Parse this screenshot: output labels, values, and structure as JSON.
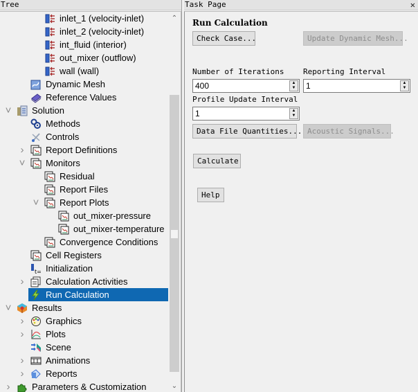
{
  "tree": {
    "header": "Tree",
    "items": [
      {
        "label": "inlet_1 (velocity-inlet)",
        "icon": "boundary-icon",
        "level": 3,
        "arrow": ""
      },
      {
        "label": "inlet_2 (velocity-inlet)",
        "icon": "boundary-icon",
        "level": 3,
        "arrow": ""
      },
      {
        "label": "int_fluid (interior)",
        "icon": "boundary-icon",
        "level": 3,
        "arrow": ""
      },
      {
        "label": "out_mixer (outflow)",
        "icon": "boundary-icon",
        "level": 3,
        "arrow": ""
      },
      {
        "label": "wall (wall)",
        "icon": "boundary-icon",
        "level": 3,
        "arrow": ""
      },
      {
        "label": "Dynamic Mesh",
        "icon": "dynamic-mesh-icon",
        "level": 2,
        "arrow": ""
      },
      {
        "label": "Reference Values",
        "icon": "book-icon",
        "level": 2,
        "arrow": ""
      },
      {
        "label": "Solution",
        "icon": "calculator-icon",
        "level": 1,
        "arrow": "expanded"
      },
      {
        "label": "Methods",
        "icon": "methods-icon",
        "level": 2,
        "arrow": ""
      },
      {
        "label": "Controls",
        "icon": "controls-icon",
        "level": 2,
        "arrow": ""
      },
      {
        "label": "Report Definitions",
        "icon": "report-icon",
        "level": 2,
        "arrow": "collapsed"
      },
      {
        "label": "Monitors",
        "icon": "report-icon",
        "level": 2,
        "arrow": "expanded"
      },
      {
        "label": "Residual",
        "icon": "report-icon",
        "level": 3,
        "arrow": ""
      },
      {
        "label": "Report Files",
        "icon": "report-icon",
        "level": 3,
        "arrow": ""
      },
      {
        "label": "Report Plots",
        "icon": "report-icon",
        "level": 3,
        "arrow": "expanded"
      },
      {
        "label": "out_mixer-pressure",
        "icon": "report-icon",
        "level": 4,
        "arrow": ""
      },
      {
        "label": "out_mixer-temperature",
        "icon": "report-icon",
        "level": 4,
        "arrow": ""
      },
      {
        "label": "Convergence Conditions",
        "icon": "report-icon",
        "level": 3,
        "arrow": ""
      },
      {
        "label": "Cell Registers",
        "icon": "report-icon",
        "level": 2,
        "arrow": ""
      },
      {
        "label": "Initialization",
        "icon": "initialization-icon",
        "level": 2,
        "arrow": ""
      },
      {
        "label": "Calculation Activities",
        "icon": "activities-icon",
        "level": 2,
        "arrow": "collapsed"
      },
      {
        "label": "Run Calculation",
        "icon": "lightning-icon",
        "level": 2,
        "arrow": "",
        "selected": true
      },
      {
        "label": "Results",
        "icon": "results-icon",
        "level": 1,
        "arrow": "expanded"
      },
      {
        "label": "Graphics",
        "icon": "palette-icon",
        "level": 2,
        "arrow": "collapsed"
      },
      {
        "label": "Plots",
        "icon": "plots-icon",
        "level": 2,
        "arrow": "collapsed"
      },
      {
        "label": "Scene",
        "icon": "scene-icon",
        "level": 2,
        "arrow": ""
      },
      {
        "label": "Animations",
        "icon": "film-icon",
        "level": 2,
        "arrow": "collapsed"
      },
      {
        "label": "Reports",
        "icon": "reports-icon",
        "level": 2,
        "arrow": "collapsed"
      },
      {
        "label": "Parameters & Customization",
        "icon": "puzzle-icon",
        "level": 1,
        "arrow": "collapsed"
      }
    ],
    "selection_color": "#0f68b2"
  },
  "task": {
    "header": "Task Page",
    "close_icon": "close-icon",
    "title": "Run Calculation",
    "check_case_label": "Check Case...",
    "update_dynamic_mesh_label": "Update Dynamic Mesh...",
    "iterations_label": "Number of Iterations",
    "iterations_value": "400",
    "reporting_interval_label": "Reporting Interval",
    "reporting_interval_value": "1",
    "profile_update_label": "Profile Update Interval",
    "profile_update_value": "1",
    "data_file_label": "Data File Quantities...",
    "acoustic_signals_label": "Acoustic Signals...",
    "calculate_label": "Calculate",
    "help_label": "Help"
  }
}
